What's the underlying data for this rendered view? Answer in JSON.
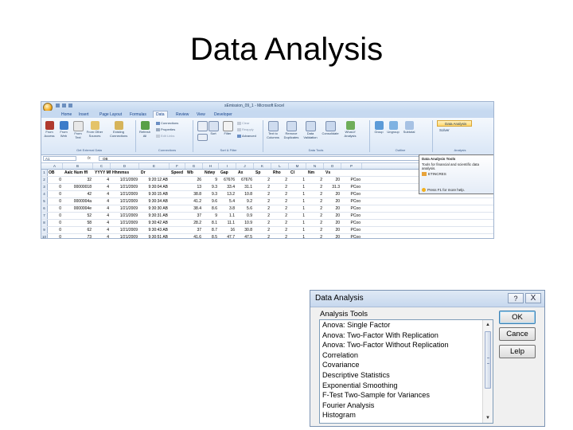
{
  "slide": {
    "title": "Data Analysis"
  },
  "excel": {
    "window_title": "sEmission_09_1 - Microsoft Excel",
    "tabs": [
      "Home",
      "Insert",
      "Page Layout",
      "Formulas",
      "Data",
      "Review",
      "View",
      "Developer"
    ],
    "active_tab": "Data",
    "ribbon": {
      "from_access": "From Access",
      "from_web": "From Web",
      "from_text": "From Text",
      "from_other": "From Other Sources",
      "existing_conn": "Existing Connections",
      "refresh_all": "Refresh All",
      "connections": "Connections",
      "properties": "Properties",
      "edit_links": "Edit Links",
      "sort": "Sort",
      "filter": "Filter",
      "clear": "Clear",
      "reapply": "Reapply",
      "advanced": "Advanced",
      "text_to_columns": "Text to Columns",
      "remove_duplicates": "Remove Duplicates",
      "data_validation": "Data Validation",
      "consolidate": "Consolidate",
      "what_if": "What-If Analysis",
      "group": "Group",
      "ungroup": "Ungroup",
      "subtotal": "Subtotal",
      "data_analysis": "Data Analysis",
      "solver": "Solver",
      "groups": {
        "external": "Get External Data",
        "connections": "Connections",
        "sort_filter": "Sort & Filter",
        "data_tools": "Data Tools",
        "outline": "Outline",
        "analysis": "Analysis"
      }
    },
    "name_box": "A1",
    "formula_value": "OB",
    "columns": [
      "A",
      "B",
      "C",
      "D",
      "E",
      "F",
      "G",
      "H",
      "I",
      "J",
      "K",
      "L",
      "M",
      "N",
      "O",
      "P"
    ],
    "header_row": [
      "OB",
      "Aalc Num ffl",
      "YYYY MM DD",
      "Hhmmss",
      "Dr",
      "Speed",
      "Wb",
      "Ndwy",
      "Gap",
      "Ax",
      "Sp",
      "Rho",
      "Cl",
      "Nm",
      "Vs",
      ""
    ],
    "rows": [
      [
        "0",
        "32",
        "4",
        "1/21/2009",
        "9:20:12 AB",
        "",
        "26",
        "9",
        "67676",
        "67676",
        "2",
        "2",
        "1",
        "2",
        "20",
        "PCoo"
      ],
      [
        "0",
        "00000018",
        "4",
        "1/21/2009",
        "9:30:04 AB",
        "",
        "13",
        "9.3",
        "33.4",
        "31.1",
        "2",
        "2",
        "1",
        "2",
        "31.3",
        "PCoo"
      ],
      [
        "0",
        "42",
        "4",
        "1/21/2009",
        "9:30:15 AB",
        "",
        "38.8",
        "9.3",
        "13.2",
        "10.8",
        "2",
        "2",
        "1",
        "2",
        "20",
        "PCoo"
      ],
      [
        "0",
        "0000004a",
        "4",
        "1/21/2009",
        "9:30:34 AB",
        "",
        "41.2",
        "9.6",
        "5.4",
        "9.2",
        "2",
        "2",
        "1",
        "2",
        "20",
        "PCoo"
      ],
      [
        "0",
        "0000004e",
        "4",
        "1/21/2009",
        "9:30:30 AB",
        "",
        "38.4",
        "8.6",
        "3.8",
        "5.6",
        "2",
        "2",
        "1",
        "2",
        "20",
        "PCoo"
      ],
      [
        "0",
        "52",
        "4",
        "1/21/2009",
        "9:30:31 AB",
        "",
        "37",
        "9",
        "1.1",
        "0.9",
        "2",
        "2",
        "1",
        "2",
        "20",
        "PCoo"
      ],
      [
        "0",
        "58",
        "4",
        "1/21/2009",
        "9:30:42 AB",
        "",
        "28.2",
        "8.1",
        "11.1",
        "10.9",
        "2",
        "2",
        "1",
        "2",
        "20",
        "PCoo"
      ],
      [
        "0",
        "62",
        "4",
        "1/21/2009",
        "9:30:43 AB",
        "",
        "37",
        "8.7",
        "16",
        "30.8",
        "2",
        "2",
        "1",
        "2",
        "20",
        "PCoo"
      ],
      [
        "0",
        "73",
        "4",
        "1/21/2009",
        "9:30:51 AB",
        "",
        "41.6",
        "8.5",
        "47.7",
        "47.5",
        "2",
        "2",
        "1",
        "2",
        "20",
        "PCoo"
      ]
    ],
    "row_numbers": [
      "1",
      "2",
      "3",
      "4",
      "5",
      "6",
      "7",
      "8",
      "9",
      "10"
    ],
    "tooltip": {
      "title": "Data Analysis Tools",
      "body": "Tools for financial and scientific data analysis.",
      "addin": "ETINCRES",
      "help": "Press F1 for more help."
    }
  },
  "dialog": {
    "title": "Data Analysis",
    "help_glyph": "?",
    "close_glyph": "X",
    "tools_label": "Analysis Tools",
    "items": [
      "Anova: Single Factor",
      "Anova: Two-Factor With Replication",
      "Anova: Two-Factor Without Replication",
      "Correlation",
      "Covariance",
      "Descriptive Statistics",
      "Exponential Smoothing",
      "F-Test Two-Sample for Variances",
      "Fourier Analysis",
      "Histogram"
    ],
    "ok": "OK",
    "cancel": "Cance",
    "help": "Lelp",
    "scroll_up": "▲",
    "scroll_down": "▼"
  }
}
